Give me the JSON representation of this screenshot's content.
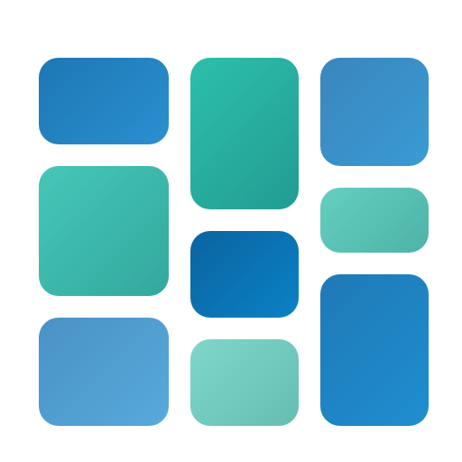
{
  "logo": {
    "tiles": [
      {
        "id": "t1",
        "from": "#1e77b5",
        "to": "#2a8fd0"
      },
      {
        "id": "t2",
        "from": "#46c7b8",
        "to": "#33a89d"
      },
      {
        "id": "t3",
        "from": "#4a92c5",
        "to": "#58a9dc"
      },
      {
        "id": "t4",
        "from": "#2dbfab",
        "to": "#229c92"
      },
      {
        "id": "t5",
        "from": "#0b63a1",
        "to": "#0a82c5"
      },
      {
        "id": "t6",
        "from": "#7fd6c9",
        "to": "#66bdb3"
      },
      {
        "id": "t7",
        "from": "#3a86bd",
        "to": "#3a9ad4"
      },
      {
        "id": "t8",
        "from": "#64cfc0",
        "to": "#4eb2a8"
      },
      {
        "id": "t9",
        "from": "#1f79b6",
        "to": "#1f8ed0"
      }
    ]
  }
}
